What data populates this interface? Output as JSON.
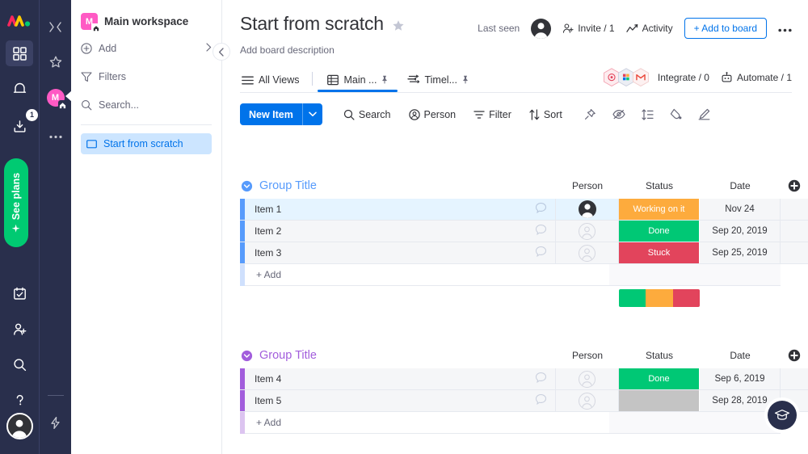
{
  "rail": {
    "logo": "monday-logo",
    "items": [
      {
        "name": "home-grid",
        "icon": "grid-icon",
        "active": true
      },
      {
        "name": "notifications",
        "icon": "bell-icon",
        "active": false
      },
      {
        "name": "inbox",
        "icon": "inbox-icon",
        "active": false,
        "badge": "1"
      }
    ],
    "see_plans_label": "See plans",
    "bottom_items": [
      {
        "name": "my-week",
        "icon": "calendar-check-icon"
      },
      {
        "name": "invite-members",
        "icon": "person-add-icon"
      },
      {
        "name": "search-everything",
        "icon": "search-icon"
      },
      {
        "name": "help",
        "icon": "question-mark-icon"
      }
    ],
    "avatar_label": "user-avatar"
  },
  "rail2": {
    "items": [
      {
        "name": "collapse-toggle",
        "icon": "expand-collapse-icon"
      },
      {
        "name": "favorites",
        "icon": "star-icon"
      },
      {
        "name": "main-workspace-avatar",
        "initial": "M",
        "icon": "home-icon"
      },
      {
        "name": "more-workspaces",
        "icon": "ellipsis-icon"
      }
    ],
    "bottom_icon": "lightning-bolt-icon"
  },
  "workspace": {
    "avatar_initial": "M",
    "title": "Main workspace",
    "rows": [
      {
        "label": "Add",
        "icon": "plus-circle-icon",
        "trailing": "chevron-right-icon"
      },
      {
        "label": "Filters",
        "icon": "funnel-icon"
      },
      {
        "label": "Search...",
        "icon": "search-icon"
      }
    ],
    "board": {
      "label": "Start from scratch",
      "icon": "board-icon"
    },
    "collapse_icon": "chevron-left-icon"
  },
  "board": {
    "title": "Start from scratch",
    "star_icon": "star-icon",
    "description_placeholder": "Add board description",
    "header_actions": {
      "last_seen_label": "Last seen",
      "last_seen_avatar": "person-avatar",
      "invite_label": "Invite / 1",
      "invite_icon": "person-add-icon",
      "activity_label": "Activity",
      "activity_icon": "activity-chart-icon",
      "add_to_board_label": "+ Add to board",
      "more_icon": "ellipsis-icon"
    },
    "tabs": {
      "all_views_label": "All Views",
      "all_views_icon": "hamburger-icon",
      "items": [
        {
          "label": "Main ...",
          "icon": "table-icon",
          "pin": "pin-icon",
          "active": true
        },
        {
          "label": "Timel...",
          "icon": "timeline-icon",
          "pin": "pin-icon",
          "active": false
        }
      ],
      "integrate_label": "Integrate / 0",
      "automate_label": "Automate / 1",
      "automate_icon": "robot-icon",
      "integration_icons": [
        "integration-hex-red",
        "integration-hex-multicolor",
        "gmail-hex-icon"
      ]
    },
    "toolbar": {
      "new_item_label": "New Item",
      "new_item_arrow": "chevron-down-icon",
      "buttons": [
        {
          "label": "Search",
          "icon": "search-icon"
        },
        {
          "label": "Person",
          "icon": "person-circle-icon"
        },
        {
          "label": "Filter",
          "icon": "filter-icon"
        },
        {
          "label": "Sort",
          "icon": "sort-arrows-icon"
        }
      ],
      "icon_buttons": [
        {
          "name": "pin-button",
          "icon": "pin-icon"
        },
        {
          "name": "hide-button",
          "icon": "eye-slash-icon"
        },
        {
          "name": "row-height-button",
          "icon": "row-height-icon"
        },
        {
          "name": "color-button",
          "icon": "paint-drop-icon"
        },
        {
          "name": "board-power-ups-button",
          "icon": "pen-icon"
        }
      ]
    }
  },
  "colors": {
    "accent_blue": "#0073ea",
    "group1_accent": "#579bfc",
    "group2_accent": "#a25ddc",
    "status_working": "#fdab3d",
    "status_done": "#00c875",
    "status_stuck": "#e2445c",
    "status_empty": "#c4c4c4",
    "brand_dark": "#292f4c",
    "pink": "#ff5ac4",
    "green": "#00ca72"
  },
  "groups": [
    {
      "title": "Group Title",
      "accent": "#579bfc",
      "caret_icon": "chevron-down-circle-icon",
      "columns": [
        "Person",
        "Status",
        "Date"
      ],
      "add_column_icon": "plus-circle-icon",
      "rows": [
        {
          "name": "Item 1",
          "person": "filled",
          "status": "Working on it",
          "status_color": "#fdab3d",
          "date": "Nov 24",
          "highlight": true
        },
        {
          "name": "Item 2",
          "person": "empty",
          "status": "Done",
          "status_color": "#00c875",
          "date": "Sep 20, 2019",
          "highlight": false
        },
        {
          "name": "Item 3",
          "person": "empty",
          "status": "Stuck",
          "status_color": "#e2445c",
          "date": "Sep 25, 2019",
          "highlight": false
        }
      ],
      "add_label": "+ Add",
      "summary": [
        {
          "color": "#00c875",
          "pct": 33.3
        },
        {
          "color": "#fdab3d",
          "pct": 33.3
        },
        {
          "color": "#e2445c",
          "pct": 33.4
        }
      ]
    },
    {
      "title": "Group Title",
      "accent": "#a25ddc",
      "caret_icon": "chevron-down-circle-icon",
      "columns": [
        "Person",
        "Status",
        "Date"
      ],
      "add_column_icon": "plus-circle-icon",
      "rows": [
        {
          "name": "Item 4",
          "person": "empty",
          "status": "Done",
          "status_color": "#00c875",
          "date": "Sep 6, 2019",
          "highlight": false
        },
        {
          "name": "Item 5",
          "person": "empty",
          "status": "",
          "status_color": "#c4c4c4",
          "date": "Sep 28, 2019",
          "highlight": false
        }
      ],
      "add_label": "+ Add",
      "summary": []
    }
  ],
  "fab": {
    "name": "learning-center",
    "icon": "graduation-cap-icon"
  }
}
